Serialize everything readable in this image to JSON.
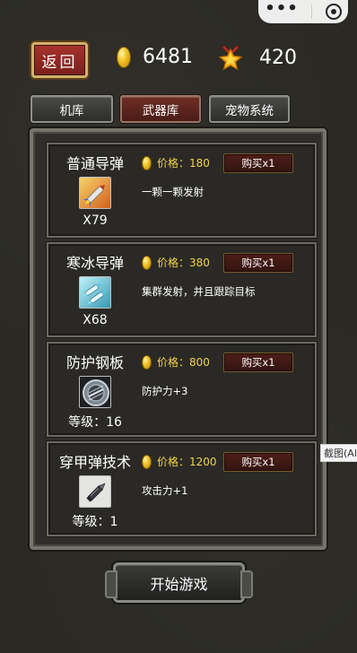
{
  "capsule": {
    "menu_icon": "more-dots-icon",
    "close_icon": "record-circle-icon"
  },
  "header": {
    "back_label": "返回",
    "gold": "6481",
    "stars": "420"
  },
  "tabs": [
    {
      "label": "机库",
      "active": false
    },
    {
      "label": "武器库",
      "active": true
    },
    {
      "label": "宠物系统",
      "active": false
    }
  ],
  "items": [
    {
      "name": "普通导弹",
      "icon": "missile-icon",
      "count": "X79",
      "price": "价格：180",
      "buy": "购买x1",
      "desc": "一颗一颗发射"
    },
    {
      "name": "寒冰导弹",
      "icon": "ice-missile-icon",
      "count": "X68",
      "price": "价格：380",
      "buy": "购买x1",
      "desc": "集群发射，并且跟踪目标"
    },
    {
      "name": "防护钢板",
      "icon": "armor-plate-icon",
      "count": "等级：16",
      "price": "价格：800",
      "buy": "购买x1",
      "desc": "防护力+3"
    },
    {
      "name": "穿甲弹技术",
      "icon": "armor-piercing-bullet-icon",
      "count": "等级：1",
      "price": "价格：1200",
      "buy": "购买x1",
      "desc": "攻击力+1"
    }
  ],
  "start_label": "开始游戏",
  "tooltip": "截图(Al"
}
